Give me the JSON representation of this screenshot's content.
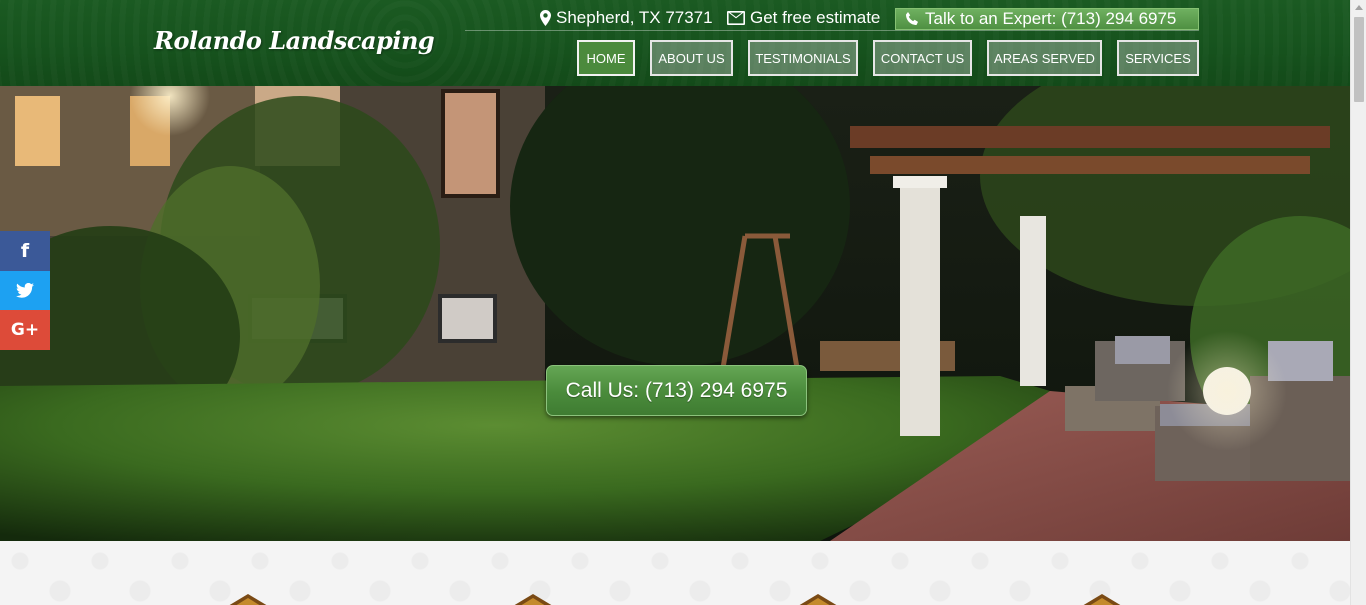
{
  "header": {
    "logo": "Rolando Landscaping",
    "location": "Shepherd, TX 77371",
    "estimate": "Get free estimate",
    "expert": "Talk to an Expert: (713) 294 6975"
  },
  "nav": [
    {
      "label": "HOME",
      "active": true
    },
    {
      "label": "ABOUT US"
    },
    {
      "label": "TESTIMONIALS"
    },
    {
      "label": "CONTACT US"
    },
    {
      "label": "AREAS SERVED"
    },
    {
      "label": "SERVICES"
    }
  ],
  "hero": {
    "call_button": "Call Us: (713) 294 6975"
  },
  "social": {
    "facebook": "f",
    "twitter_icon": "twitter-bird-icon",
    "google_plus": "G+"
  },
  "colors": {
    "header_green": "#16521d",
    "button_green": "#4b8a3d",
    "facebook": "#3b5998",
    "twitter": "#1da1f2",
    "google_plus": "#dd4b39"
  }
}
